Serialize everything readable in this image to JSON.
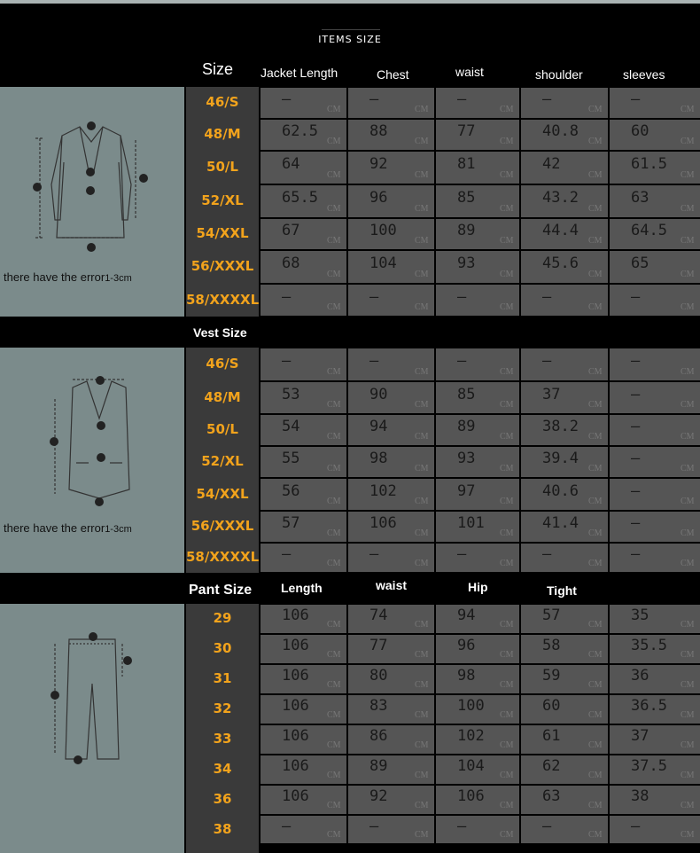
{
  "page_title": "ITEMS SIZE",
  "cm_unit": "CM",
  "dash": "—",
  "jacket": {
    "size_header": "Size",
    "columns": [
      "Jacket Length",
      "Chest",
      "waist",
      "shoulder",
      "sleeves"
    ],
    "note_main": "there have the error",
    "note_range": "1-3cm",
    "rows": [
      {
        "size": "46/S",
        "values": [
          "—",
          "—",
          "—",
          "—",
          "—"
        ]
      },
      {
        "size": "48/M",
        "values": [
          "62.5",
          "88",
          "77",
          "40.8",
          "60"
        ]
      },
      {
        "size": "50/L",
        "values": [
          "64",
          "92",
          "81",
          "42",
          "61.5"
        ]
      },
      {
        "size": "52/XL",
        "values": [
          "65.5",
          "96",
          "85",
          "43.2",
          "63"
        ]
      },
      {
        "size": "54/XXL",
        "values": [
          "67",
          "100",
          "89",
          "44.4",
          "64.5"
        ]
      },
      {
        "size": "56/XXXL",
        "values": [
          "68",
          "104",
          "93",
          "45.6",
          "65"
        ]
      },
      {
        "size": "58/XXXXL",
        "values": [
          "—",
          "—",
          "—",
          "—",
          "—"
        ]
      }
    ]
  },
  "vest": {
    "section_header": "Vest Size",
    "note_main": "there have the error",
    "note_range": "1-3cm",
    "rows": [
      {
        "size": "46/S",
        "values": [
          "—",
          "—",
          "—",
          "—",
          "—"
        ]
      },
      {
        "size": "48/M",
        "values": [
          "53",
          "90",
          "85",
          "37",
          "—"
        ]
      },
      {
        "size": "50/L",
        "values": [
          "54",
          "94",
          "89",
          "38.2",
          "—"
        ]
      },
      {
        "size": "52/XL",
        "values": [
          "55",
          "98",
          "93",
          "39.4",
          "—"
        ]
      },
      {
        "size": "54/XXL",
        "values": [
          "56",
          "102",
          "97",
          "40.6",
          "—"
        ]
      },
      {
        "size": "56/XXXL",
        "values": [
          "57",
          "106",
          "101",
          "41.4",
          "—"
        ]
      },
      {
        "size": "58/XXXXL",
        "values": [
          "—",
          "—",
          "—",
          "—",
          "—"
        ]
      }
    ]
  },
  "pant": {
    "section_header": "Pant Size",
    "columns": [
      "Length",
      "waist",
      "Hip",
      "Tight"
    ],
    "rows": [
      {
        "size": "29",
        "values": [
          "106",
          "74",
          "94",
          "57",
          "35"
        ]
      },
      {
        "size": "30",
        "values": [
          "106",
          "77",
          "96",
          "58",
          "35.5"
        ]
      },
      {
        "size": "31",
        "values": [
          "106",
          "80",
          "98",
          "59",
          "36"
        ]
      },
      {
        "size": "32",
        "values": [
          "106",
          "83",
          "100",
          "60",
          "36.5"
        ]
      },
      {
        "size": "33",
        "values": [
          "106",
          "86",
          "102",
          "61",
          "37"
        ]
      },
      {
        "size": "34",
        "values": [
          "106",
          "89",
          "104",
          "62",
          "37.5"
        ]
      },
      {
        "size": "36",
        "values": [
          "106",
          "92",
          "106",
          "63",
          "38"
        ]
      },
      {
        "size": "38",
        "values": [
          "—",
          "—",
          "—",
          "—",
          "—"
        ]
      }
    ]
  },
  "colors": {
    "size_label": "#f2a31c",
    "panel": "#7b8b8b",
    "cell": "#555555",
    "background": "#000000"
  }
}
